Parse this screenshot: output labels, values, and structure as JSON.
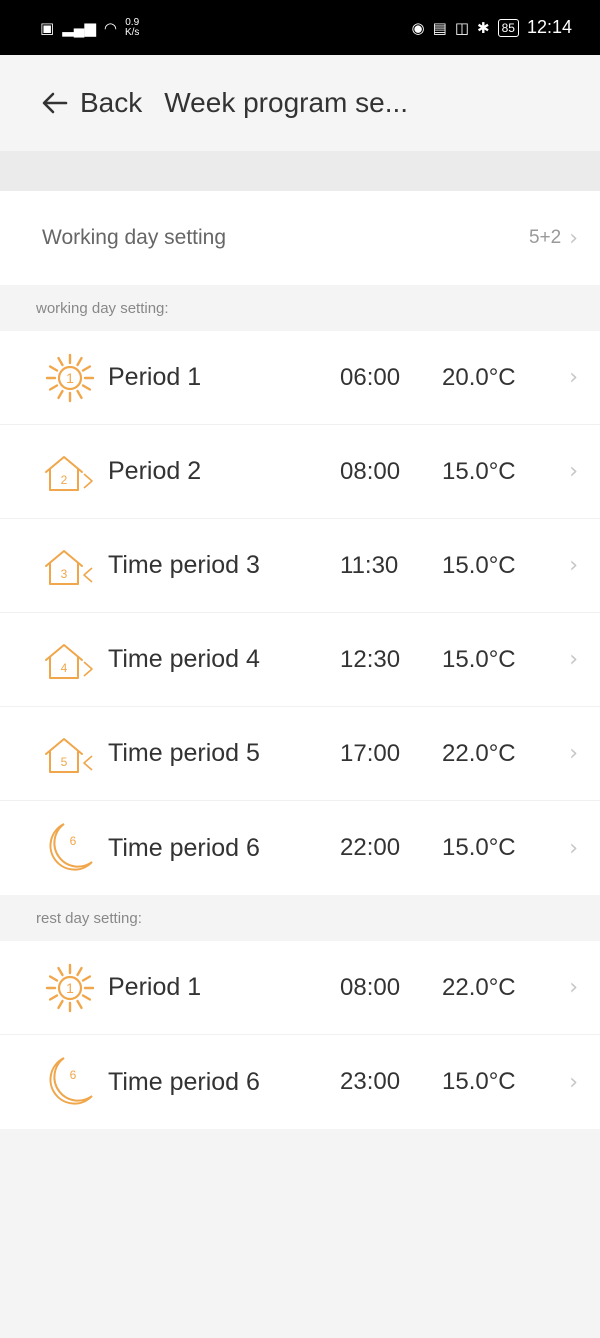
{
  "status_bar": {
    "speed_top": "0.9",
    "speed_bottom": "K/s",
    "battery": "85",
    "time": "12:14"
  },
  "nav": {
    "back_label": "Back",
    "title": "Week program se..."
  },
  "working_day_config": {
    "label": "Working day setting",
    "value": "5+2"
  },
  "sections": {
    "working": {
      "header": "working day setting:",
      "periods": [
        {
          "name": "Period 1",
          "time": "06:00",
          "temp": "20.0°C",
          "icon": "sun-1-icon",
          "num": "1"
        },
        {
          "name": "Period 2",
          "time": "08:00",
          "temp": "15.0°C",
          "icon": "house-leave-icon",
          "num": "2"
        },
        {
          "name": "Time period 3",
          "time": "11:30",
          "temp": "15.0°C",
          "icon": "house-return-icon",
          "num": "3"
        },
        {
          "name": "Time period 4",
          "time": "12:30",
          "temp": "15.0°C",
          "icon": "house-leave-icon",
          "num": "4"
        },
        {
          "name": "Time period 5",
          "time": "17:00",
          "temp": "22.0°C",
          "icon": "house-return-icon",
          "num": "5"
        },
        {
          "name": "Time period 6",
          "time": "22:00",
          "temp": "15.0°C",
          "icon": "moon-6-icon",
          "num": "6"
        }
      ]
    },
    "rest": {
      "header": "rest day setting:",
      "periods": [
        {
          "name": "Period 1",
          "time": "08:00",
          "temp": "22.0°C",
          "icon": "sun-1-icon",
          "num": "1"
        },
        {
          "name": "Time period 6",
          "time": "23:00",
          "temp": "15.0°C",
          "icon": "moon-6-icon",
          "num": "6"
        }
      ]
    }
  },
  "colors": {
    "accent": "#f0a64a",
    "text": "#333333",
    "muted": "#999999",
    "chevron": "#c6c6c6"
  }
}
